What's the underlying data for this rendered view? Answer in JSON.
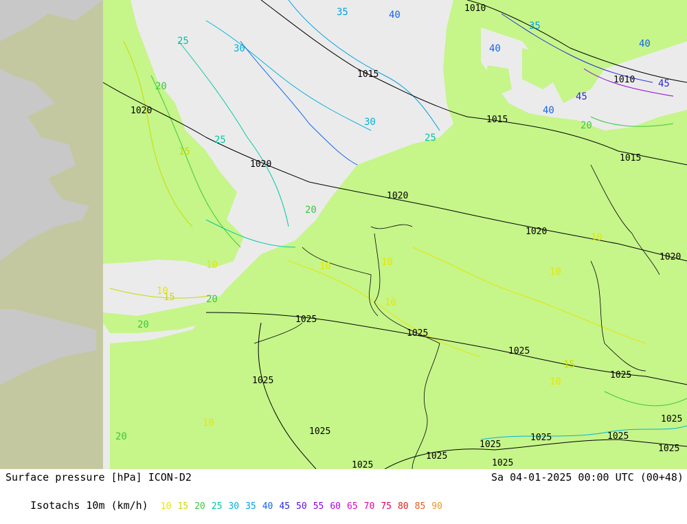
{
  "footer": {
    "title": "Surface pressure [hPa] ICON-D2",
    "datetime": "Sa 04-01-2025 00:00 UTC (00+48)",
    "isotachs_label": "Isotachs 10m (km/h)"
  },
  "legend": [
    {
      "value": "10",
      "color": "#e6e600"
    },
    {
      "value": "15",
      "color": "#c8dc00"
    },
    {
      "value": "20",
      "color": "#3cc83c"
    },
    {
      "value": "25",
      "color": "#00c8a0"
    },
    {
      "value": "30",
      "color": "#00b4dc"
    },
    {
      "value": "35",
      "color": "#00a0e6"
    },
    {
      "value": "40",
      "color": "#1464f0"
    },
    {
      "value": "45",
      "color": "#2828dc"
    },
    {
      "value": "50",
      "color": "#5a14dc"
    },
    {
      "value": "55",
      "color": "#8c00dc"
    },
    {
      "value": "60",
      "color": "#b400dc"
    },
    {
      "value": "65",
      "color": "#dc00c8"
    },
    {
      "value": "70",
      "color": "#e60096"
    },
    {
      "value": "75",
      "color": "#e6005a"
    },
    {
      "value": "80",
      "color": "#e61e1e"
    },
    {
      "value": "85",
      "color": "#e65a1e"
    },
    {
      "value": "90",
      "color": "#e6961e"
    }
  ],
  "map": {
    "colors": {
      "land_model": "#c6f58a",
      "sea_model": "#ebebeb",
      "land_outside": "#c3c8a0",
      "sea_outside": "#c8c8c8"
    },
    "isobar_labels": [
      "1010",
      "1010",
      "1015",
      "1015",
      "1015",
      "1020",
      "1020",
      "1020",
      "1020",
      "1020",
      "1025",
      "1025",
      "1025",
      "1025",
      "1025",
      "1025",
      "1025",
      "1025",
      "1025",
      "1025",
      "1025",
      "1025",
      "1025",
      "1025"
    ],
    "isotach_labels": [
      "10",
      "10",
      "10",
      "10",
      "10",
      "10",
      "10",
      "10",
      "10",
      "15",
      "15",
      "15",
      "20",
      "20",
      "20",
      "20",
      "20",
      "20",
      "25",
      "25",
      "25",
      "30",
      "30",
      "35",
      "35",
      "40",
      "40",
      "40",
      "40",
      "45",
      "45"
    ]
  }
}
